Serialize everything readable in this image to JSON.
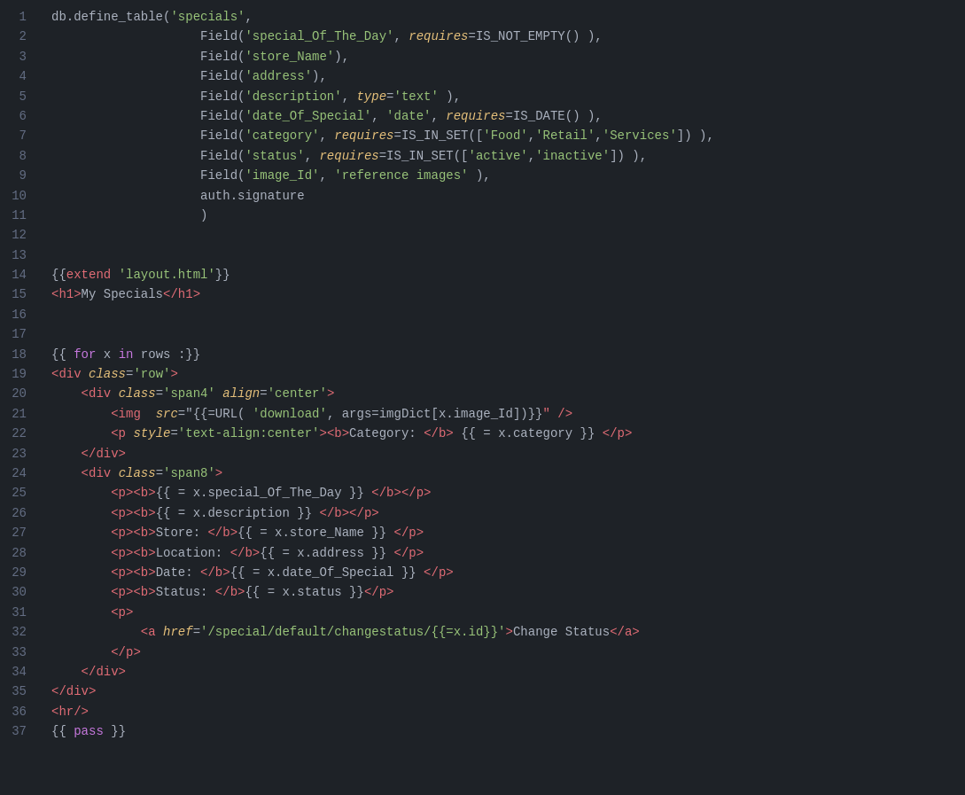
{
  "editor": {
    "background": "#1e2227",
    "lines": [
      {
        "num": 1,
        "tokens": [
          {
            "text": "db.define_table(",
            "cls": "c-white"
          },
          {
            "text": "'specials'",
            "cls": "c-green"
          },
          {
            "text": ",",
            "cls": "c-white"
          }
        ]
      },
      {
        "num": 2,
        "tokens": [
          {
            "text": "                    Field(",
            "cls": "c-white"
          },
          {
            "text": "'special_Of_The_Day'",
            "cls": "c-green"
          },
          {
            "text": ", ",
            "cls": "c-white"
          },
          {
            "text": "requires",
            "cls": "c-italic-orange"
          },
          {
            "text": "=IS_NOT_EMPTY() ),",
            "cls": "c-white"
          }
        ]
      },
      {
        "num": 3,
        "tokens": [
          {
            "text": "                    Field(",
            "cls": "c-white"
          },
          {
            "text": "'store_Name'",
            "cls": "c-green"
          },
          {
            "text": "),",
            "cls": "c-white"
          }
        ]
      },
      {
        "num": 4,
        "tokens": [
          {
            "text": "                    Field(",
            "cls": "c-white"
          },
          {
            "text": "'address'",
            "cls": "c-green"
          },
          {
            "text": "),",
            "cls": "c-white"
          }
        ]
      },
      {
        "num": 5,
        "tokens": [
          {
            "text": "                    Field(",
            "cls": "c-white"
          },
          {
            "text": "'description'",
            "cls": "c-green"
          },
          {
            "text": ", ",
            "cls": "c-white"
          },
          {
            "text": "type",
            "cls": "c-italic-orange"
          },
          {
            "text": "=",
            "cls": "c-white"
          },
          {
            "text": "'text'",
            "cls": "c-green"
          },
          {
            "text": " ),",
            "cls": "c-white"
          }
        ]
      },
      {
        "num": 6,
        "tokens": [
          {
            "text": "                    Field(",
            "cls": "c-white"
          },
          {
            "text": "'date_Of_Special'",
            "cls": "c-green"
          },
          {
            "text": ", ",
            "cls": "c-white"
          },
          {
            "text": "'date'",
            "cls": "c-green"
          },
          {
            "text": ", ",
            "cls": "c-white"
          },
          {
            "text": "requires",
            "cls": "c-italic-orange"
          },
          {
            "text": "=IS_DATE() ),",
            "cls": "c-white"
          }
        ]
      },
      {
        "num": 7,
        "tokens": [
          {
            "text": "                    Field(",
            "cls": "c-white"
          },
          {
            "text": "'category'",
            "cls": "c-green"
          },
          {
            "text": ", ",
            "cls": "c-white"
          },
          {
            "text": "requires",
            "cls": "c-italic-orange"
          },
          {
            "text": "=IS_IN_SET([",
            "cls": "c-white"
          },
          {
            "text": "'Food'",
            "cls": "c-green"
          },
          {
            "text": ",",
            "cls": "c-white"
          },
          {
            "text": "'Retail'",
            "cls": "c-green"
          },
          {
            "text": ",",
            "cls": "c-white"
          },
          {
            "text": "'Services'",
            "cls": "c-green"
          },
          {
            "text": "]) ),",
            "cls": "c-white"
          }
        ]
      },
      {
        "num": 8,
        "tokens": [
          {
            "text": "                    Field(",
            "cls": "c-white"
          },
          {
            "text": "'status'",
            "cls": "c-green"
          },
          {
            "text": ", ",
            "cls": "c-white"
          },
          {
            "text": "requires",
            "cls": "c-italic-orange"
          },
          {
            "text": "=IS_IN_SET([",
            "cls": "c-white"
          },
          {
            "text": "'active'",
            "cls": "c-green"
          },
          {
            "text": ",",
            "cls": "c-white"
          },
          {
            "text": "'inactive'",
            "cls": "c-green"
          },
          {
            "text": "]) ),",
            "cls": "c-white"
          }
        ]
      },
      {
        "num": 9,
        "tokens": [
          {
            "text": "                    Field(",
            "cls": "c-white"
          },
          {
            "text": "'image_Id'",
            "cls": "c-green"
          },
          {
            "text": ", ",
            "cls": "c-white"
          },
          {
            "text": "'reference images'",
            "cls": "c-green"
          },
          {
            "text": " ),",
            "cls": "c-white"
          }
        ]
      },
      {
        "num": 10,
        "tokens": [
          {
            "text": "                    auth.signature",
            "cls": "c-white"
          }
        ]
      },
      {
        "num": 11,
        "tokens": [
          {
            "text": "                    )",
            "cls": "c-white"
          }
        ]
      },
      {
        "num": 12,
        "tokens": []
      },
      {
        "num": 13,
        "tokens": []
      },
      {
        "num": 14,
        "tokens": [
          {
            "text": "{{",
            "cls": "c-white"
          },
          {
            "text": "extend ",
            "cls": "c-red"
          },
          {
            "text": "'layout.html'",
            "cls": "c-green"
          },
          {
            "text": "}}",
            "cls": "c-white"
          }
        ]
      },
      {
        "num": 15,
        "tokens": [
          {
            "text": "<h1>",
            "cls": "c-red"
          },
          {
            "text": "My Specials",
            "cls": "c-white"
          },
          {
            "text": "</h1>",
            "cls": "c-red"
          }
        ]
      },
      {
        "num": 16,
        "tokens": []
      },
      {
        "num": 17,
        "tokens": []
      },
      {
        "num": 18,
        "tokens": [
          {
            "text": "{{ ",
            "cls": "c-white"
          },
          {
            "text": "for",
            "cls": "c-purple"
          },
          {
            "text": " x ",
            "cls": "c-white"
          },
          {
            "text": "in",
            "cls": "c-purple"
          },
          {
            "text": " rows :}}",
            "cls": "c-white"
          }
        ]
      },
      {
        "num": 19,
        "tokens": [
          {
            "text": "<div ",
            "cls": "c-red"
          },
          {
            "text": "class",
            "cls": "c-italic-orange"
          },
          {
            "text": "=",
            "cls": "c-white"
          },
          {
            "text": "'row'",
            "cls": "c-green"
          },
          {
            "text": ">",
            "cls": "c-red"
          }
        ]
      },
      {
        "num": 20,
        "tokens": [
          {
            "text": "    <div ",
            "cls": "c-red"
          },
          {
            "text": "class",
            "cls": "c-italic-orange"
          },
          {
            "text": "=",
            "cls": "c-white"
          },
          {
            "text": "'span4'",
            "cls": "c-green"
          },
          {
            "text": " ",
            "cls": "c-white"
          },
          {
            "text": "align",
            "cls": "c-italic-orange"
          },
          {
            "text": "=",
            "cls": "c-white"
          },
          {
            "text": "'center'",
            "cls": "c-green"
          },
          {
            "text": ">",
            "cls": "c-red"
          }
        ]
      },
      {
        "num": 21,
        "tokens": [
          {
            "text": "        <img  ",
            "cls": "c-red"
          },
          {
            "text": "src",
            "cls": "c-italic-orange"
          },
          {
            "text": "=\"{{=URL( ",
            "cls": "c-white"
          },
          {
            "text": "'download'",
            "cls": "c-green"
          },
          {
            "text": ", args=imgDict[x.image_Id])}}",
            "cls": "c-white"
          },
          {
            "text": "\" />",
            "cls": "c-red"
          }
        ]
      },
      {
        "num": 22,
        "tokens": [
          {
            "text": "        <p ",
            "cls": "c-red"
          },
          {
            "text": "style",
            "cls": "c-italic-orange"
          },
          {
            "text": "=",
            "cls": "c-white"
          },
          {
            "text": "'text-align:center'",
            "cls": "c-green"
          },
          {
            "text": ">",
            "cls": "c-red"
          },
          {
            "text": "<b>",
            "cls": "c-red"
          },
          {
            "text": "Category: ",
            "cls": "c-white"
          },
          {
            "text": "</b>",
            "cls": "c-red"
          },
          {
            "text": " {{ = x.category }} ",
            "cls": "c-white"
          },
          {
            "text": "</p>",
            "cls": "c-red"
          }
        ]
      },
      {
        "num": 23,
        "tokens": [
          {
            "text": "    </div>",
            "cls": "c-red"
          }
        ]
      },
      {
        "num": 24,
        "tokens": [
          {
            "text": "    <div ",
            "cls": "c-red"
          },
          {
            "text": "class",
            "cls": "c-italic-orange"
          },
          {
            "text": "=",
            "cls": "c-white"
          },
          {
            "text": "'span8'",
            "cls": "c-green"
          },
          {
            "text": ">",
            "cls": "c-red"
          }
        ]
      },
      {
        "num": 25,
        "tokens": [
          {
            "text": "        <p>",
            "cls": "c-red"
          },
          {
            "text": "<b>",
            "cls": "c-red"
          },
          {
            "text": "{{ = x.special_Of_The_Day }} ",
            "cls": "c-white"
          },
          {
            "text": "</b>",
            "cls": "c-red"
          },
          {
            "text": "</p>",
            "cls": "c-red"
          }
        ]
      },
      {
        "num": 26,
        "tokens": [
          {
            "text": "        <p>",
            "cls": "c-red"
          },
          {
            "text": "<b>",
            "cls": "c-red"
          },
          {
            "text": "{{ = x.description }} ",
            "cls": "c-white"
          },
          {
            "text": "</b>",
            "cls": "c-red"
          },
          {
            "text": "</p>",
            "cls": "c-red"
          }
        ]
      },
      {
        "num": 27,
        "tokens": [
          {
            "text": "        <p>",
            "cls": "c-red"
          },
          {
            "text": "<b>",
            "cls": "c-red"
          },
          {
            "text": "Store: ",
            "cls": "c-white"
          },
          {
            "text": "</b>",
            "cls": "c-red"
          },
          {
            "text": "{{ = x.store_Name }} ",
            "cls": "c-white"
          },
          {
            "text": "</p>",
            "cls": "c-red"
          }
        ]
      },
      {
        "num": 28,
        "tokens": [
          {
            "text": "        <p>",
            "cls": "c-red"
          },
          {
            "text": "<b>",
            "cls": "c-red"
          },
          {
            "text": "Location: ",
            "cls": "c-white"
          },
          {
            "text": "</b>",
            "cls": "c-red"
          },
          {
            "text": "{{ = x.address }} ",
            "cls": "c-white"
          },
          {
            "text": "</p>",
            "cls": "c-red"
          }
        ]
      },
      {
        "num": 29,
        "tokens": [
          {
            "text": "        <p>",
            "cls": "c-red"
          },
          {
            "text": "<b>",
            "cls": "c-red"
          },
          {
            "text": "Date: ",
            "cls": "c-white"
          },
          {
            "text": "</b>",
            "cls": "c-red"
          },
          {
            "text": "{{ = x.date_Of_Special }} ",
            "cls": "c-white"
          },
          {
            "text": "</p>",
            "cls": "c-red"
          }
        ]
      },
      {
        "num": 30,
        "tokens": [
          {
            "text": "        <p>",
            "cls": "c-red"
          },
          {
            "text": "<b>",
            "cls": "c-red"
          },
          {
            "text": "Status: ",
            "cls": "c-white"
          },
          {
            "text": "</b>",
            "cls": "c-red"
          },
          {
            "text": "{{ = x.status }}",
            "cls": "c-white"
          },
          {
            "text": "</p>",
            "cls": "c-red"
          }
        ]
      },
      {
        "num": 31,
        "tokens": [
          {
            "text": "        <p>",
            "cls": "c-red"
          }
        ]
      },
      {
        "num": 32,
        "tokens": [
          {
            "text": "            <a ",
            "cls": "c-red"
          },
          {
            "text": "href",
            "cls": "c-italic-orange"
          },
          {
            "text": "=",
            "cls": "c-white"
          },
          {
            "text": "'/special/default/changestatus/{{=x.id}}'",
            "cls": "c-green"
          },
          {
            "text": ">",
            "cls": "c-red"
          },
          {
            "text": "Change Status",
            "cls": "c-white"
          },
          {
            "text": "</a>",
            "cls": "c-red"
          }
        ]
      },
      {
        "num": 33,
        "tokens": [
          {
            "text": "        </p>",
            "cls": "c-red"
          }
        ]
      },
      {
        "num": 34,
        "tokens": [
          {
            "text": "    </div>",
            "cls": "c-red"
          }
        ]
      },
      {
        "num": 35,
        "tokens": [
          {
            "text": "</div>",
            "cls": "c-red"
          }
        ]
      },
      {
        "num": 36,
        "tokens": [
          {
            "text": "<hr/>",
            "cls": "c-red"
          }
        ]
      },
      {
        "num": 37,
        "tokens": [
          {
            "text": "{{ ",
            "cls": "c-white"
          },
          {
            "text": "pass",
            "cls": "c-purple"
          },
          {
            "text": " }}",
            "cls": "c-white"
          }
        ]
      }
    ]
  }
}
